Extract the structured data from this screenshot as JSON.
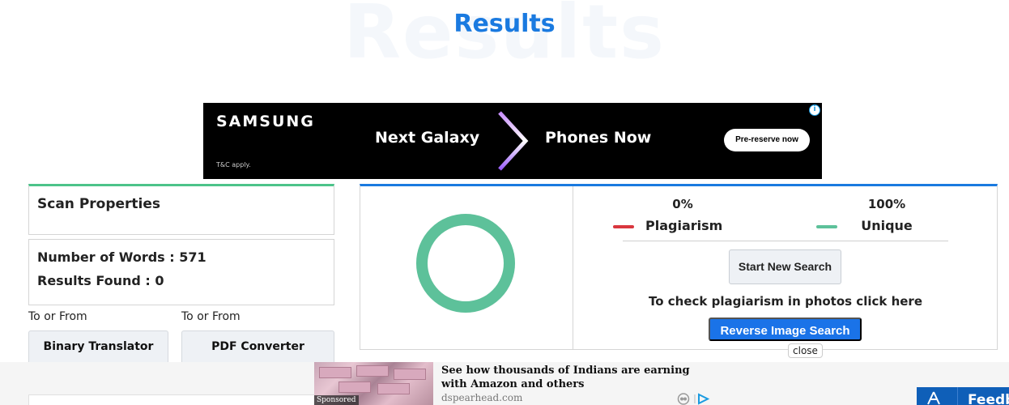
{
  "header": {
    "background_title": "Results",
    "title": "Results"
  },
  "ad": {
    "brand": "SAMSUNG",
    "headline_left": "Next Galaxy",
    "headline_right": "Phones Now",
    "cta": "Pre-reserve now",
    "fine_print": "T&C apply.",
    "info_glyph": "i"
  },
  "scan_properties": {
    "title": "Scan Properties",
    "words_label": "Number of Words : 571",
    "results_label": "Results Found : 0"
  },
  "tools": [
    {
      "label": "To or From",
      "button": "Binary Translator"
    },
    {
      "label": "To or From",
      "button": "PDF Converter"
    }
  ],
  "results": {
    "plagiarism_percent": "0%",
    "unique_percent": "100%",
    "plagiarism_label": "Plagiarism",
    "unique_label": "Unique",
    "plagiarism_value": 0,
    "unique_value": 100,
    "plagiarism_color": "#d9363e",
    "unique_color": "#5dc19a",
    "new_search_button": "Start New Search",
    "photo_prompt": "To check plagiarism in photos click here",
    "reverse_button": "Reverse Image Search"
  },
  "close_label": "close",
  "sponsored": {
    "label": "Sponsored",
    "headline": "See how thousands of Indians are earning with Amazon and others",
    "source": "dspearhead.com"
  },
  "feedback": {
    "label": "Feedb"
  },
  "colors": {
    "accent": "#1a7ae0",
    "scan_border": "#4cc38a"
  }
}
